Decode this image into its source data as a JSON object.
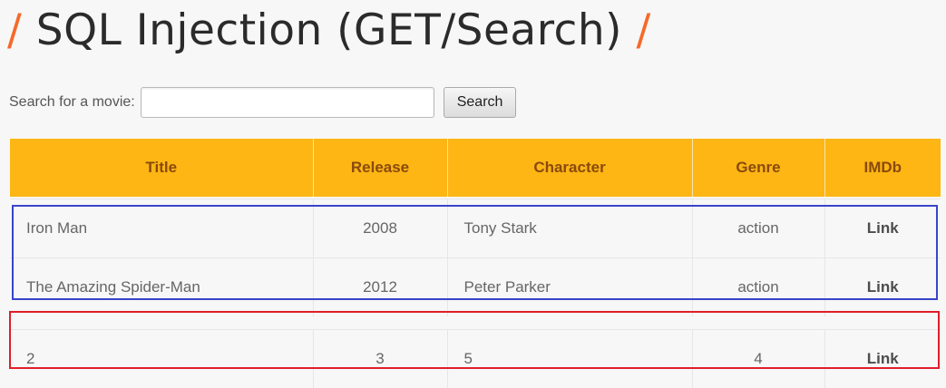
{
  "header": {
    "slash_left": "/",
    "title": "SQL Injection (GET/Search)",
    "slash_right": "/"
  },
  "search": {
    "label": "Search for a movie:",
    "value": "",
    "placeholder": "",
    "button_label": "Search"
  },
  "table": {
    "columns": [
      "Title",
      "Release",
      "Character",
      "Genre",
      "IMDb"
    ],
    "rows": [
      {
        "title": "Iron Man",
        "release": "2008",
        "character": "Tony Stark",
        "genre": "action",
        "imdb": "Link"
      },
      {
        "title": "The Amazing Spider-Man",
        "release": "2012",
        "character": "Peter Parker",
        "genre": "action",
        "imdb": "Link"
      },
      {
        "title": "2",
        "release": "3",
        "character": "5",
        "genre": "4",
        "imdb": "Link"
      }
    ]
  },
  "colors": {
    "accent_slash": "#f56a2a",
    "table_header_bg": "#fdb614",
    "table_header_text": "#8a4a0c",
    "highlight_blue": "#3a45c9",
    "highlight_red": "#e01e2a"
  }
}
